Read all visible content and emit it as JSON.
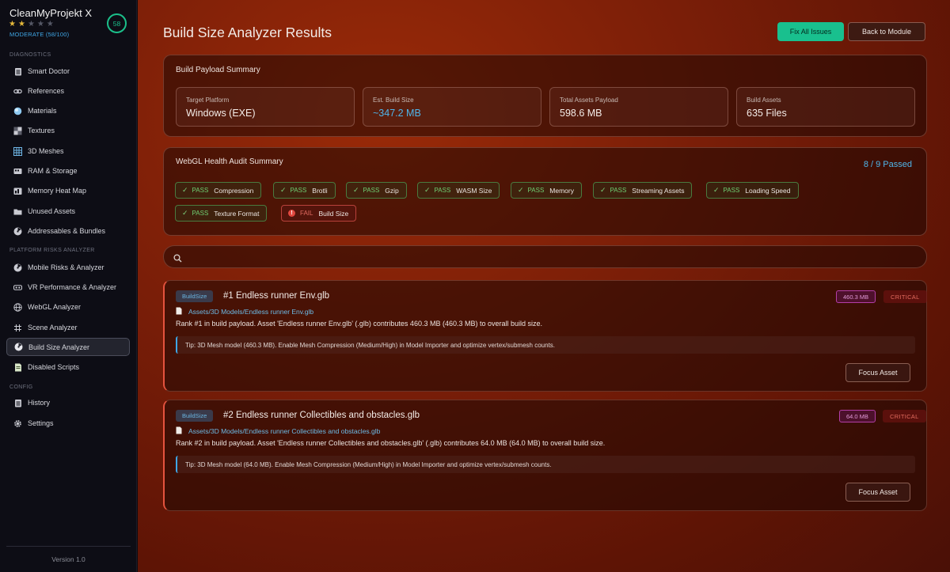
{
  "app": {
    "name": "CleanMyProjekt X",
    "score": "58",
    "stars_filled": 2,
    "stars_total": 5,
    "rating_label": "MODERATE (58/100)",
    "version": "Version 1.0"
  },
  "sidebar": {
    "diagnostics_label": "DIAGNOSTICS",
    "diagnostics": [
      {
        "label": "Smart Doctor",
        "icon": "clipboard-icon"
      },
      {
        "label": "References",
        "icon": "link-icon"
      },
      {
        "label": "Materials",
        "icon": "material-sphere-icon"
      },
      {
        "label": "Textures",
        "icon": "texture-grid-icon"
      },
      {
        "label": "3D Meshes",
        "icon": "mesh-grid-icon"
      },
      {
        "label": "RAM & Storage",
        "icon": "storage-icon"
      },
      {
        "label": "Memory Heat Map",
        "icon": "heatmap-icon"
      },
      {
        "label": "Unused Assets",
        "icon": "folder-icon"
      },
      {
        "label": "Addressables & Bundles",
        "icon": "radiation-icon"
      }
    ],
    "platform_label": "PLATFORM RISKS ANALYZER",
    "platform": [
      {
        "label": "Mobile Risks & Analyzer",
        "icon": "radiation-icon"
      },
      {
        "label": "VR Performance & Analyzer",
        "icon": "vr-icon"
      },
      {
        "label": "WebGL Analyzer",
        "icon": "globe-icon"
      },
      {
        "label": "Scene Analyzer",
        "icon": "hash-icon"
      },
      {
        "label": "Build Size Analyzer",
        "icon": "radiation-icon"
      },
      {
        "label": "Disabled Scripts",
        "icon": "script-icon"
      }
    ],
    "config_label": "CONFIG",
    "config": [
      {
        "label": "History",
        "icon": "clipboard-icon"
      },
      {
        "label": "Settings",
        "icon": "gear-icon"
      }
    ]
  },
  "header": {
    "title": "Build Size Analyzer Results",
    "fix_label": "Fix All Issues",
    "back_label": "Back to Module"
  },
  "summary": {
    "title": "Build Payload Summary",
    "stats": [
      {
        "label": "Target Platform",
        "value": "Windows (EXE)"
      },
      {
        "label": "Est. Build Size",
        "value": "~347.2 MB"
      },
      {
        "label": "Total Assets Payload",
        "value": "598.6 MB"
      },
      {
        "label": "Build Assets",
        "value": "635 Files"
      }
    ]
  },
  "audit": {
    "title": "WebGL Health Audit Summary",
    "passed": "8 / 9 Passed",
    "checks": [
      {
        "status": "PASS",
        "name": "Compression"
      },
      {
        "status": "PASS",
        "name": "Brotli"
      },
      {
        "status": "PASS",
        "name": "Gzip"
      },
      {
        "status": "PASS",
        "name": "WASM Size"
      },
      {
        "status": "PASS",
        "name": "Memory"
      },
      {
        "status": "PASS",
        "name": "Streaming Assets"
      },
      {
        "status": "PASS",
        "name": "Loading Speed"
      },
      {
        "status": "PASS",
        "name": "Texture Format"
      },
      {
        "status": "FAIL",
        "name": "Build Size"
      }
    ]
  },
  "search": {
    "placeholder": "",
    "value": ""
  },
  "results": [
    {
      "tag": "BuildSize",
      "title": "#1 Endless runner Env.glb",
      "size": "460.3 MB",
      "severity": "CRITICAL",
      "path": "Assets/3D Models/Endless runner Env.glb",
      "description": "Rank #1 in build payload. Asset 'Endless runner Env.glb' (.glb) contributes 460.3 MB (460.3 MB) to overall build size.",
      "tip": "Tip: 3D Mesh model (460.3 MB). Enable Mesh Compression (Medium/High) in Model Importer and optimize vertex/submesh counts.",
      "action": "Focus Asset"
    },
    {
      "tag": "BuildSize",
      "title": "#2 Endless runner Collectibles and obstacles.glb",
      "size": "64.0 MB",
      "severity": "CRITICAL",
      "path": "Assets/3D Models/Endless runner Collectibles and obstacles.glb",
      "description": "Rank #2 in build payload. Asset 'Endless runner Collectibles and obstacles.glb' (.glb) contributes 64.0 MB (64.0 MB) to overall build size.",
      "tip": "Tip: 3D Mesh model (64.0 MB). Enable Mesh Compression (Medium/High) in Model Importer and optimize vertex/submesh counts.",
      "action": "Focus Asset"
    }
  ],
  "colors": {
    "accent_green": "#19c08e",
    "accent_blue": "#4fb5ea",
    "critical_red": "#e5533e",
    "size_magenta": "#b33ea8"
  }
}
